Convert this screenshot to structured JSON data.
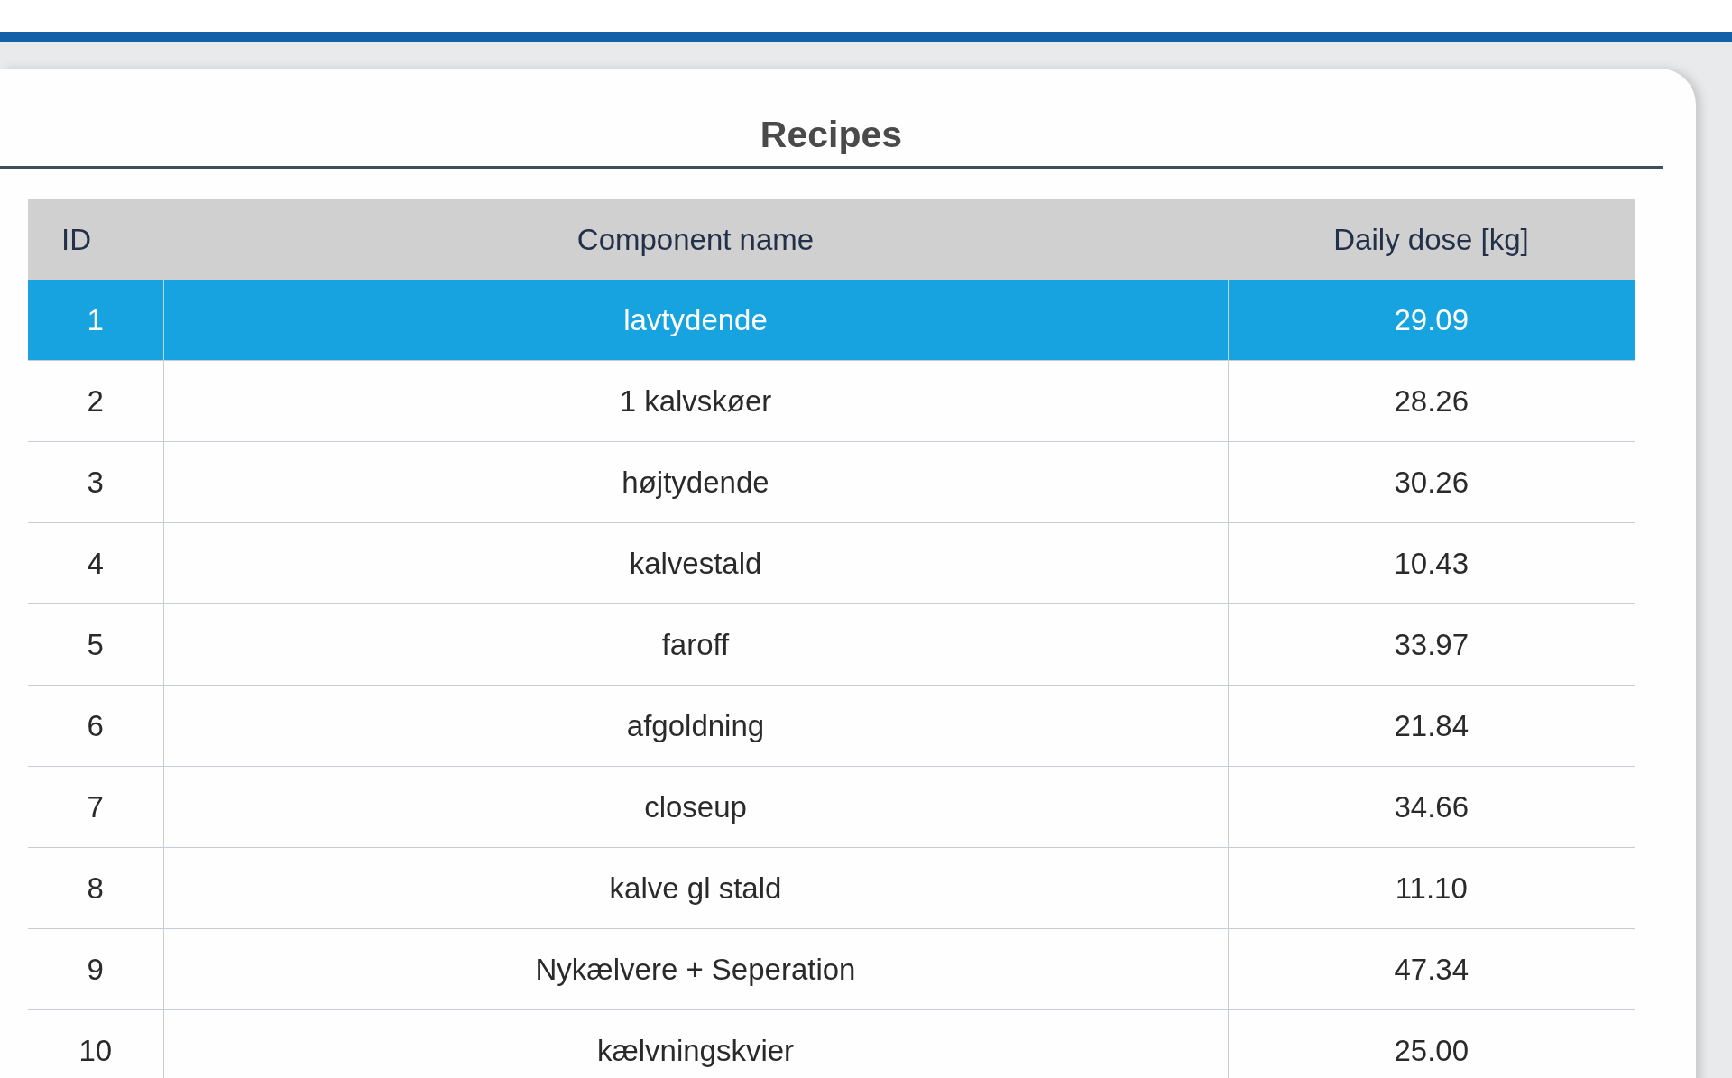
{
  "title": "Recipes",
  "table": {
    "columns": [
      "ID",
      "Component name",
      "Daily dose [kg]"
    ],
    "rows": [
      {
        "id": "1",
        "name": "lavtydende",
        "dose": "29.09",
        "selected": true
      },
      {
        "id": "2",
        "name": "1 kalvskøer",
        "dose": "28.26",
        "selected": false
      },
      {
        "id": "3",
        "name": "højtydende",
        "dose": "30.26",
        "selected": false
      },
      {
        "id": "4",
        "name": "kalvestald",
        "dose": "10.43",
        "selected": false
      },
      {
        "id": "5",
        "name": "faroff",
        "dose": "33.97",
        "selected": false
      },
      {
        "id": "6",
        "name": "afgoldning",
        "dose": "21.84",
        "selected": false
      },
      {
        "id": "7",
        "name": "closeup",
        "dose": "34.66",
        "selected": false
      },
      {
        "id": "8",
        "name": "kalve gl stald",
        "dose": "11.10",
        "selected": false
      },
      {
        "id": "9",
        "name": "Nykælvere + Seperation",
        "dose": "47.34",
        "selected": false
      },
      {
        "id": "10",
        "name": "kælvningskvier",
        "dose": "25.00",
        "selected": false
      }
    ]
  }
}
